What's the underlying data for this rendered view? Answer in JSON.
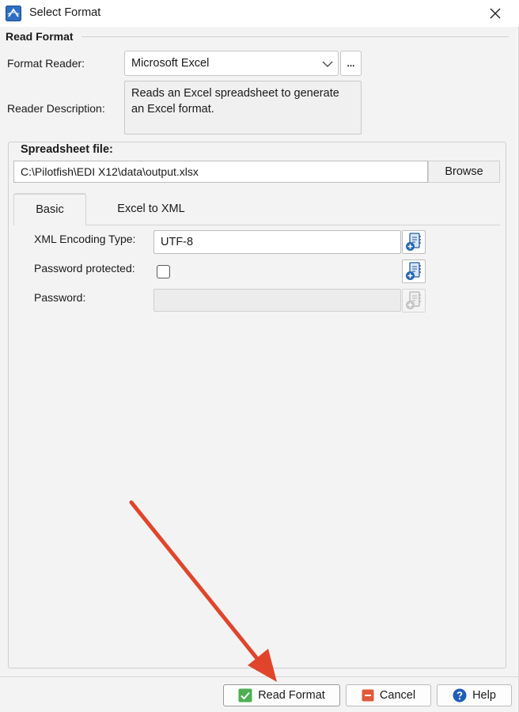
{
  "window": {
    "title": "Select Format"
  },
  "read_format": {
    "group_label": "Read Format",
    "format_reader_label": "Format Reader:",
    "format_reader_value": "Microsoft Excel",
    "browse_dots_label": "...",
    "reader_description_label": "Reader Description:",
    "reader_description_text": "Reads an Excel spreadsheet to generate an Excel format."
  },
  "spreadsheet": {
    "legend": "Spreadsheet file:",
    "file_path": "C:\\Pilotfish\\EDI X12\\data\\output.xlsx",
    "browse_label": "Browse"
  },
  "tabs": [
    {
      "label": "Basic",
      "selected": true
    },
    {
      "label": "Excel to XML",
      "selected": false
    }
  ],
  "basic": {
    "encoding_label": "XML Encoding Type:",
    "encoding_value": "UTF-8",
    "password_protected_label": "Password protected:",
    "password_protected_checked": false,
    "password_label": "Password:",
    "password_value": ""
  },
  "footer": {
    "read_format_label": "Read Format",
    "cancel_label": "Cancel",
    "help_label": "Help"
  },
  "colors": {
    "annotation_arrow": "#e0452c",
    "check_green": "#4caf50",
    "cancel_red": "#e05a3a",
    "help_blue": "#1f5fb8"
  },
  "icons": {
    "app": "app-icon",
    "close": "close-icon",
    "dropdown": "chevron-down-icon",
    "variable": "variable-picker-icon",
    "read_format": "green-check-icon",
    "cancel": "red-cancel-icon",
    "help": "help-question-icon"
  }
}
